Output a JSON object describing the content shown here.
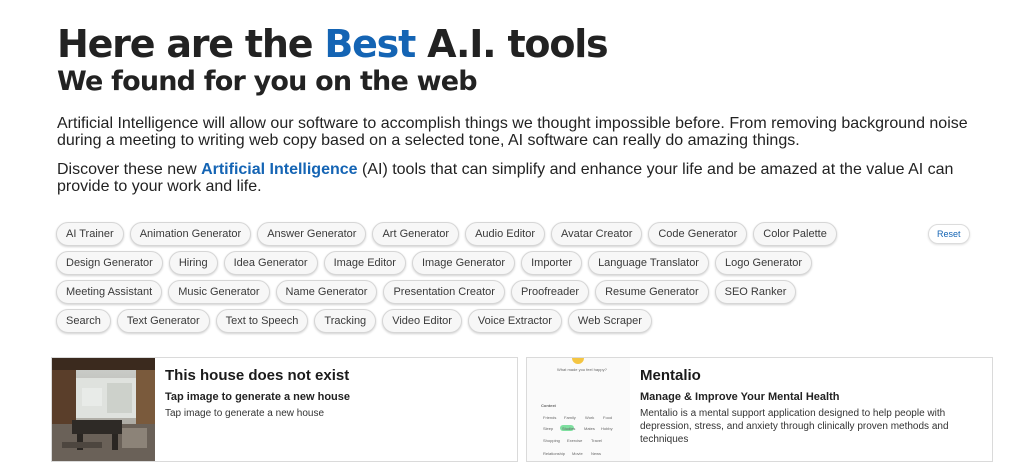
{
  "hero": {
    "title_pre": "Here are the ",
    "title_accent": "Best",
    "title_post": " A.I. tools",
    "subtitle": "We found for you on the web"
  },
  "intro": {
    "p1": "Artificial Intelligence will allow our software to accomplish things we thought impossible before. From removing background noise during a meeting to writing web copy based on a selected tone, AI software can really do amazing things.",
    "p2_pre": "Discover these new ",
    "p2_link": "Artificial Intelligence",
    "p2_post": " (AI) tools that can simplify and enhance your life and be amazed at the value AI can provide to your work and life."
  },
  "tags": {
    "row1": [
      "AI Trainer",
      "Animation Generator",
      "Answer Generator",
      "Art Generator",
      "Audio Editor",
      "Avatar Creator",
      "Code Generator",
      "Color Palette"
    ],
    "row2": [
      "Design Generator",
      "Hiring",
      "Idea Generator",
      "Image Editor",
      "Image Generator",
      "Importer",
      "Language Translator",
      "Logo Generator"
    ],
    "row3": [
      "Meeting Assistant",
      "Music Generator",
      "Name Generator",
      "Presentation Creator",
      "Proofreader",
      "Resume Generator",
      "SEO Ranker"
    ],
    "row4": [
      "Search",
      "Text Generator",
      "Text to Speech",
      "Tracking",
      "Video Editor",
      "Voice Extractor",
      "Web Scraper"
    ],
    "reset_label": "Reset"
  },
  "cards": [
    {
      "title": "This house does not exist",
      "subtitle": "Tap image to generate a new house",
      "description": "Tap image to generate a new house"
    },
    {
      "title": "Mentalio",
      "subtitle": "Manage & Improve Your Mental Health",
      "description": "Mentalio is a mental support application designed to help people with depression, stress, and anxiety through clinically proven methods and techniques",
      "thumb_texts": [
        "What made you feel happy?",
        "Context",
        "Friends",
        "Family",
        "Work",
        "Food",
        "Sleep",
        "Studies",
        "Mates",
        "Hobby",
        "Shopping",
        "Exercise",
        "Travel",
        "Relationship",
        "Movie",
        "News"
      ]
    }
  ],
  "colors": {
    "accent": "#1464b4"
  }
}
